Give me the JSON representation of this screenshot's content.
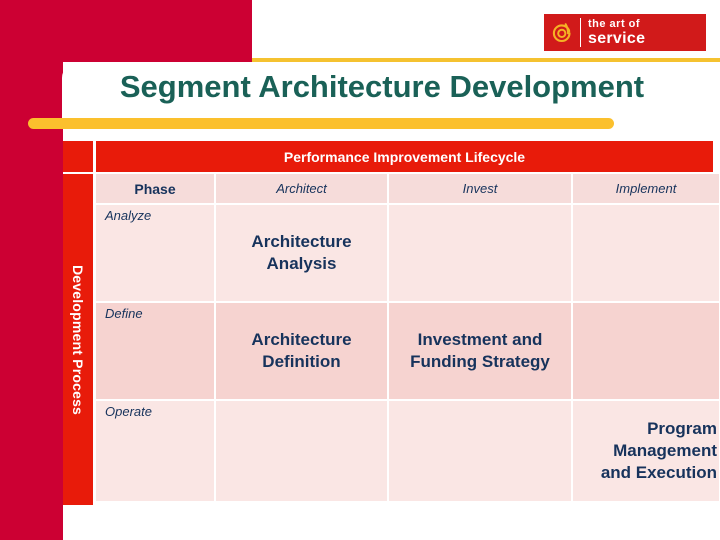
{
  "brand": {
    "logo_mark": "at-spiral-icon",
    "logo_line1": "the art of",
    "logo_line2": "service",
    "logo_bg": "#D11A1A"
  },
  "title": "Segment Architecture Development",
  "colors": {
    "crimson": "#CC0033",
    "red": "#E81B0A",
    "yellow": "#FBC02D",
    "title_teal": "#1A6157",
    "cell_text": "#17335C",
    "cell_light": "#FAE6E4",
    "cell_mid": "#F6D3D0",
    "cell_head": "#F6DCDA"
  },
  "matrix": {
    "column_group_header": "Performance Improvement Lifecycle",
    "row_group_header": "Development Process",
    "phase_header": "Phase",
    "columns": [
      "Architect",
      "Invest",
      "Implement"
    ],
    "rows": [
      {
        "label": "Analyze",
        "cells": [
          "Architecture Analysis",
          "",
          ""
        ]
      },
      {
        "label": "Define",
        "cells": [
          "Architecture Definition",
          "Investment and Funding Strategy",
          ""
        ]
      },
      {
        "label": "Operate",
        "cells": [
          "",
          "",
          "Program Management and Execution"
        ]
      }
    ]
  }
}
